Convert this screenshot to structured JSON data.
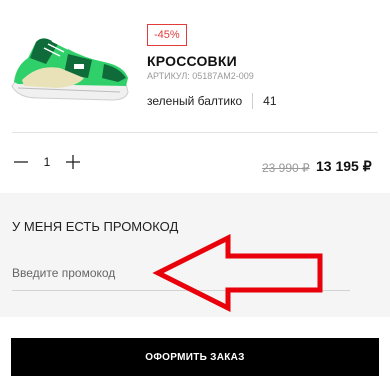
{
  "product": {
    "discount_badge": "-45%",
    "name": "КРОССОВКИ",
    "article": "АРТИКУЛ: 05187AM2-009",
    "color": "зеленый балтико",
    "size": "41"
  },
  "quantity": {
    "minus_symbol": "−",
    "value": "1",
    "plus_symbol": "+"
  },
  "price": {
    "old": "23 990 ₽",
    "current": "13 195 ₽"
  },
  "promo": {
    "title": "У МЕНЯ ЕСТЬ ПРОМОКОД",
    "placeholder": "Введите промокод"
  },
  "checkout": {
    "label": "ОФОРМИТЬ ЗАКАЗ"
  },
  "colors": {
    "accent_red": "#e23b3b",
    "shoe_green": "#2fd06a",
    "shoe_dark_green": "#0f6b3a",
    "button_black": "#000000",
    "promo_bg": "#f5f5f5"
  },
  "icons": [
    "sneaker-image",
    "minus-icon",
    "plus-icon",
    "arrow-annotation"
  ]
}
